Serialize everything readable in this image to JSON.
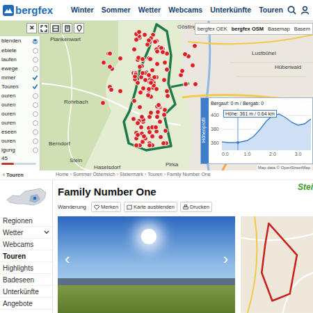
{
  "header": {
    "logo": "bergfex",
    "nav": [
      "Winter",
      "Sommer",
      "Wetter",
      "Webcams",
      "Unterkünfte",
      "Touren"
    ]
  },
  "map": {
    "toolbar": {
      "close": "✕"
    },
    "filters": {
      "title": "blenden",
      "items": [
        {
          "label": "ebiete",
          "checked": false
        },
        {
          "label": "laufen",
          "checked": false
        },
        {
          "label": "ewege",
          "checked": false
        },
        {
          "label": "mmer",
          "checked": true
        },
        {
          "label": "Touren",
          "checked": true
        },
        {
          "label": "ouren",
          "checked": false
        },
        {
          "label": "ouren",
          "checked": false
        },
        {
          "label": "ouren",
          "checked": false
        },
        {
          "label": "ouren",
          "checked": false
        },
        {
          "label": "eseen",
          "checked": false
        },
        {
          "label": "ouren",
          "checked": false
        },
        {
          "label": "igung",
          "checked": false
        }
      ],
      "slope": {
        "value": "45",
        "level": 0.35
      }
    },
    "types": [
      {
        "label": "bergfex OEK",
        "selected": false
      },
      {
        "label": "bergfex OSM",
        "selected": true
      },
      {
        "label": "Basemap",
        "selected": false
      },
      {
        "label": "Basem",
        "selected": false
      }
    ],
    "labels": [
      "Plankenwart",
      "Rohrbach",
      "Berndorf",
      "Stein",
      "Haselsdorf",
      "Pirka",
      "Lustbühel",
      "Hüberwald",
      "Gösting"
    ],
    "attribution": "Map data © OpenStreetMap"
  },
  "profile": {
    "tab": "Höhenprofil",
    "summary": "Bergauf: 0 m / Bergab: 0",
    "tooltip": "Höhe: 361 m / 0.64 km",
    "y_ticks": [
      "400",
      "380",
      "360"
    ],
    "x_ticks": [
      "0.0",
      "1.0",
      "2.0",
      "3.0"
    ],
    "values": [
      362,
      361,
      361,
      362,
      364,
      370,
      380,
      392,
      400,
      402,
      397,
      390,
      386,
      388,
      395
    ]
  },
  "breadcrumb": {
    "back_icon": "‹",
    "back": "Touren",
    "separator": "›",
    "items": [
      "Home",
      "Sommer Österreich",
      "Steiermark",
      "Touren",
      "Family Number One"
    ]
  },
  "sidebar": {
    "items": [
      {
        "label": "Regionen",
        "selected": false,
        "expandable": false
      },
      {
        "label": "Wetter",
        "selected": false,
        "expandable": true
      },
      {
        "label": "Webcams",
        "selected": false,
        "expandable": false
      },
      {
        "label": "Touren",
        "selected": true,
        "expandable": false
      },
      {
        "label": "Highlights",
        "selected": false,
        "expandable": false
      },
      {
        "label": "Badeseen",
        "selected": false,
        "expandable": false
      },
      {
        "label": "Unterkünfte",
        "selected": false,
        "expandable": false
      },
      {
        "label": "Angebote",
        "selected": false,
        "expandable": false
      }
    ]
  },
  "tour": {
    "title": "Family Number One",
    "type": "Wanderung",
    "actions": [
      "Merken",
      "Karte ausblenden",
      "Drucken"
    ],
    "badge": "Stei"
  },
  "photo": {
    "prev": "‹",
    "next": "›"
  }
}
